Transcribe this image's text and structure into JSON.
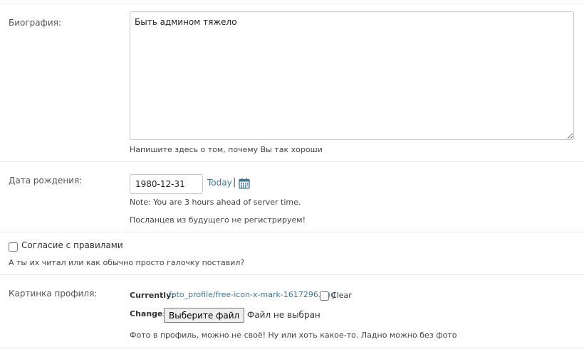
{
  "biography": {
    "label": "Биография:",
    "value": "Быть админом тяжело",
    "help": "Напишите здесь о том, почему Вы так хороши"
  },
  "birth_date": {
    "label": "Дата рождения:",
    "value": "1980-12-31",
    "today_link": "Today",
    "separator": "|",
    "calendar_icon": "calendar-icon",
    "note": "Note: You are 3 hours ahead of server time.",
    "help": "Посланцев из будущего не регистрируем!"
  },
  "agreement": {
    "label": "Согласие с правилами",
    "checked": false,
    "help": "А ты их читал или как обычно просто галочку поставил?"
  },
  "profile_picture": {
    "label": "Картинка профиля:",
    "currently_label": "Currently:",
    "current_file": "foto_profile/free-icon-x-mark-1617296.png",
    "clear_label": "Clear",
    "change_label": "Change:",
    "choose_button": "Выберите файл",
    "no_file_text": "Файл не выбран",
    "help": "Фото в профиль, можно не своё! Ну или хоть какое-то. Ладно можно без фото"
  },
  "colors": {
    "link": "#417690",
    "border": "#e6e6e6"
  }
}
